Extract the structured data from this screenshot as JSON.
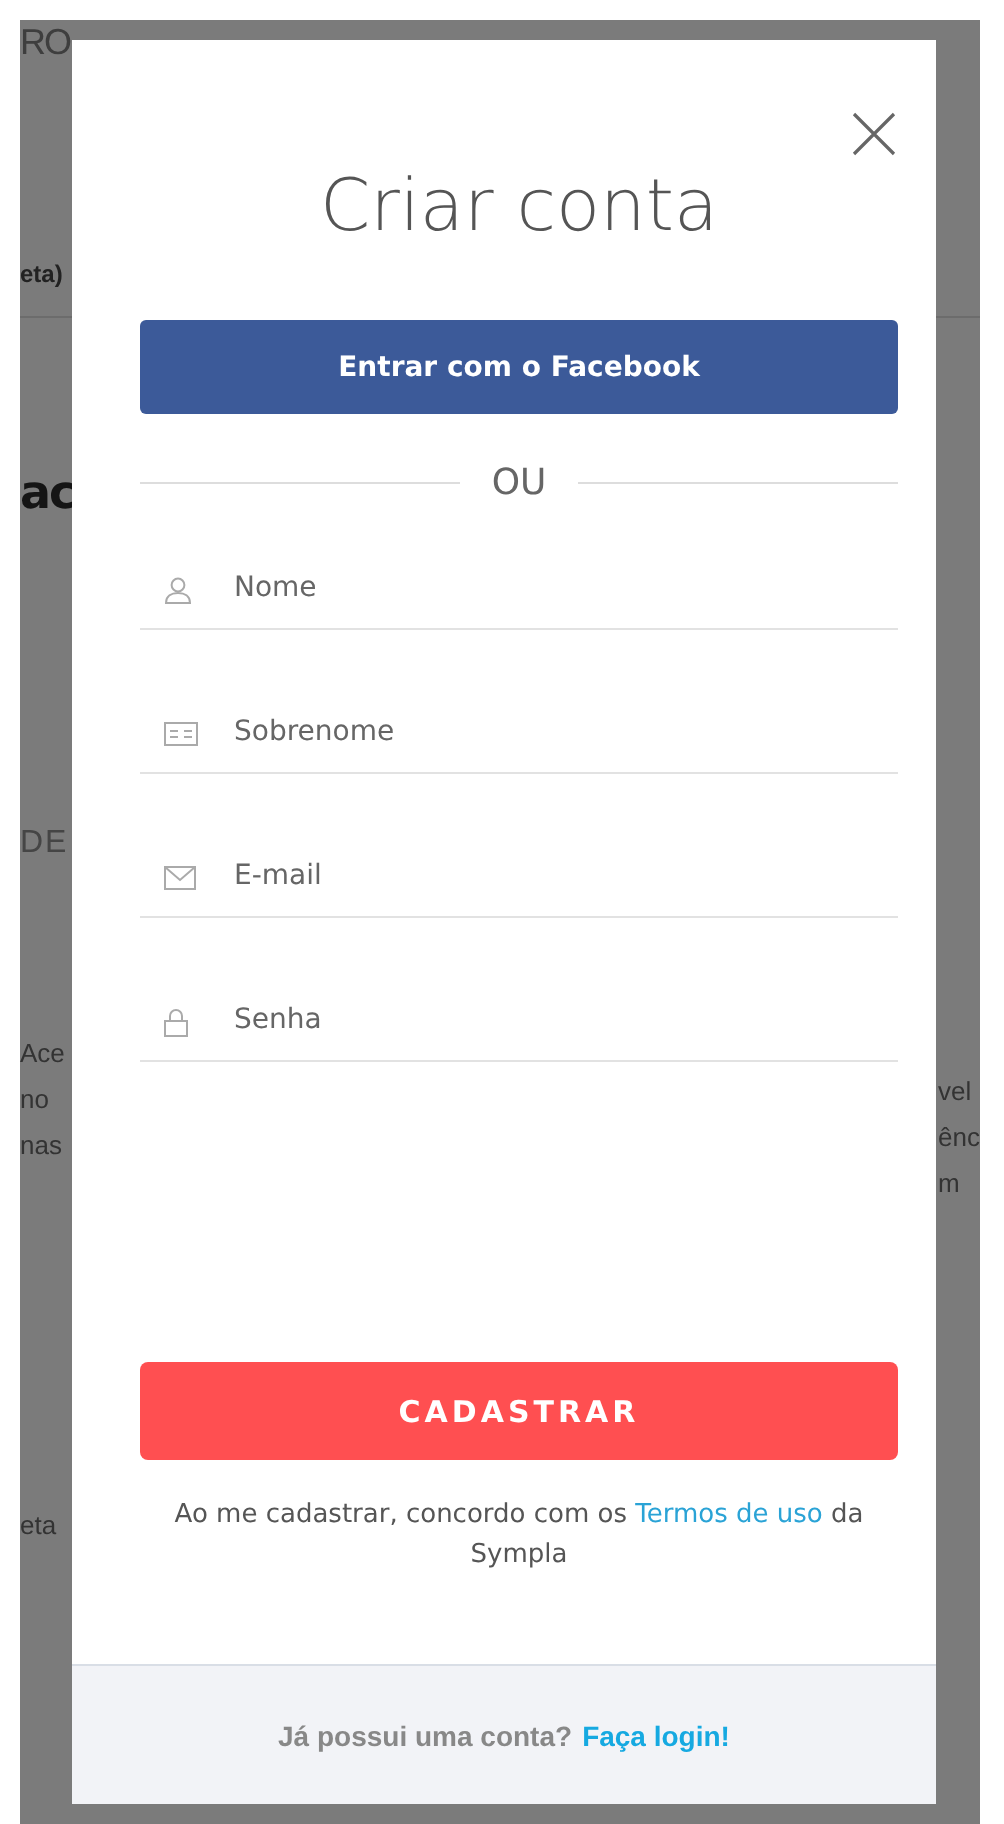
{
  "background": {
    "left": [
      {
        "kind": "heading",
        "text": "RO"
      },
      {
        "kind": "bold",
        "text": "eta)"
      },
      {
        "kind": "title",
        "text": "ac"
      },
      {
        "kind": "caps",
        "text": "DE"
      },
      {
        "kind": "text",
        "text": "Ace"
      },
      {
        "kind": "text",
        "text": "no"
      },
      {
        "kind": "text",
        "text": "nas"
      },
      {
        "kind": "text",
        "text": "eta"
      }
    ],
    "right": [
      {
        "kind": "text",
        "text": "vel"
      },
      {
        "kind": "text",
        "text": "ênc"
      },
      {
        "kind": "text",
        "text": "m"
      }
    ]
  },
  "modal": {
    "title": "Criar conta",
    "facebook_button": "Entrar com o Facebook",
    "divider_text": "OU",
    "fields": [
      {
        "kind": "person",
        "placeholder": "Nome"
      },
      {
        "kind": "card",
        "placeholder": "Sobrenome"
      },
      {
        "kind": "mail",
        "placeholder": "E-mail"
      },
      {
        "kind": "lock",
        "placeholder": "Senha"
      }
    ],
    "submit_button": "CADASTRAR",
    "terms": {
      "before": "Ao me cadastrar, concordo com os",
      "link": "Termos de uso",
      "after": "da Sympla"
    },
    "footer": {
      "question": "Já possui uma conta?",
      "link": "Faça login!"
    }
  }
}
